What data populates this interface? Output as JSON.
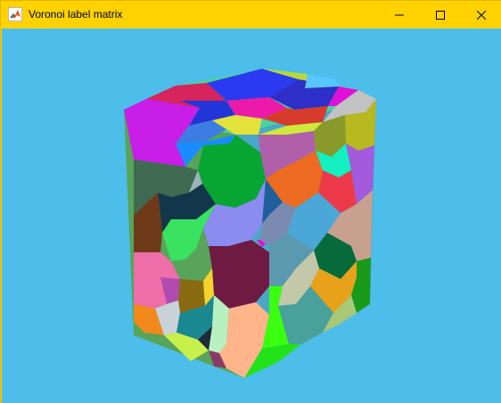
{
  "window": {
    "title": "Voronoi label matrix",
    "controls": [
      "minimize",
      "maximize",
      "close"
    ]
  },
  "figure": {
    "background": "#4dbeea",
    "titlebar_color": "#ffd200",
    "icon": "matlab-icon",
    "plot": "voronoi-cube"
  }
}
